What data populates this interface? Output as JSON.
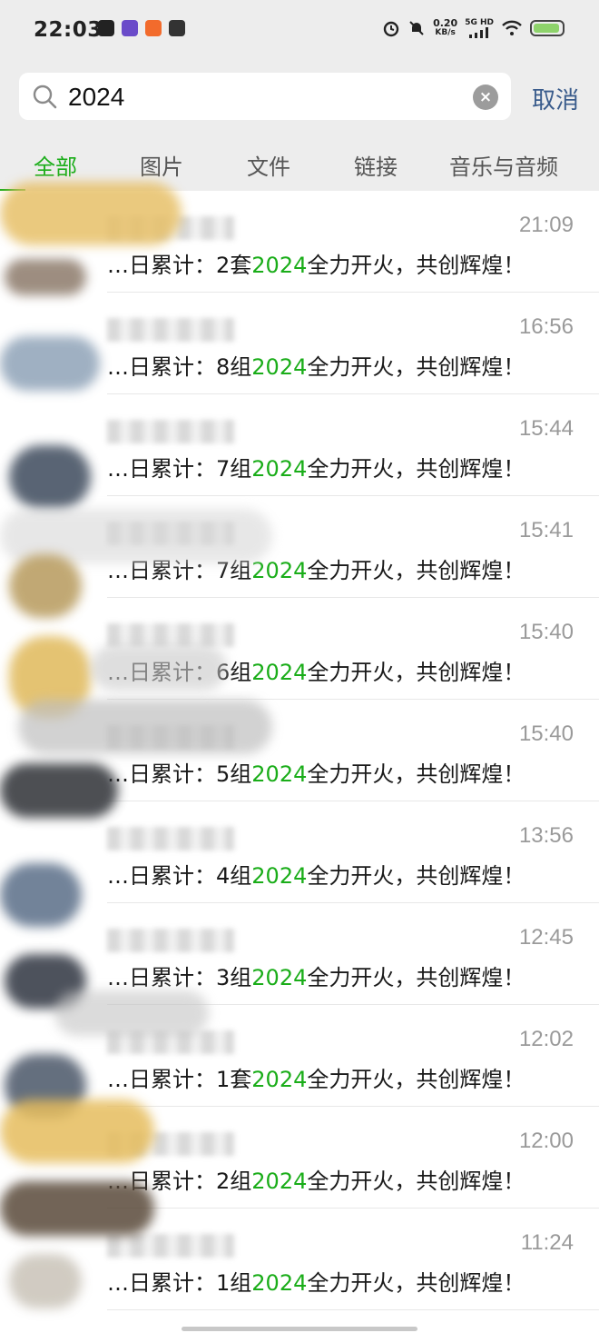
{
  "status_bar": {
    "time": "22:03",
    "net_speed_value": "0.20",
    "net_speed_unit": "KB/s",
    "net_type": "5G HD"
  },
  "search": {
    "query": "2024",
    "cancel_label": "取消"
  },
  "tabs": [
    {
      "label": "全部",
      "active": true
    },
    {
      "label": "图片",
      "active": false
    },
    {
      "label": "文件",
      "active": false
    },
    {
      "label": "链接",
      "active": false
    },
    {
      "label": "音乐与音频",
      "active": false
    }
  ],
  "results": [
    {
      "time": "21:09",
      "prefix": "…日累计：2套",
      "highlight": "2024",
      "suffix": "全力开火，共创辉煌！"
    },
    {
      "time": "16:56",
      "prefix": "…日累计：8组",
      "highlight": "2024",
      "suffix": "全力开火，共创辉煌！"
    },
    {
      "time": "15:44",
      "prefix": "…日累计：7组",
      "highlight": "2024",
      "suffix": "全力开火，共创辉煌！"
    },
    {
      "time": "15:41",
      "prefix": "…日累计：7组",
      "highlight": "2024",
      "suffix": "全力开火，共创辉煌！"
    },
    {
      "time": "15:40",
      "prefix": "…日累计：6组",
      "highlight": "2024",
      "suffix": "全力开火，共创辉煌！"
    },
    {
      "time": "15:40",
      "prefix": "…日累计：5组",
      "highlight": "2024",
      "suffix": "全力开火，共创辉煌！"
    },
    {
      "time": "13:56",
      "prefix": "…日累计：4组",
      "highlight": "2024",
      "suffix": "全力开火，共创辉煌！"
    },
    {
      "time": "12:45",
      "prefix": "…日累计：3组",
      "highlight": "2024",
      "suffix": "全力开火，共创辉煌！"
    },
    {
      "time": "12:02",
      "prefix": "…日累计：1套",
      "highlight": "2024",
      "suffix": "全力开火，共创辉煌！"
    },
    {
      "time": "12:00",
      "prefix": "…日累计：2组",
      "highlight": "2024",
      "suffix": "全力开火，共创辉煌！"
    },
    {
      "time": "11:24",
      "prefix": "…日累计：1组",
      "highlight": "2024",
      "suffix": "全力开火，共创辉煌！"
    }
  ],
  "colors": {
    "accent": "#1aad19",
    "cancel": "#3a5c8c",
    "header_bg": "#ededed"
  }
}
